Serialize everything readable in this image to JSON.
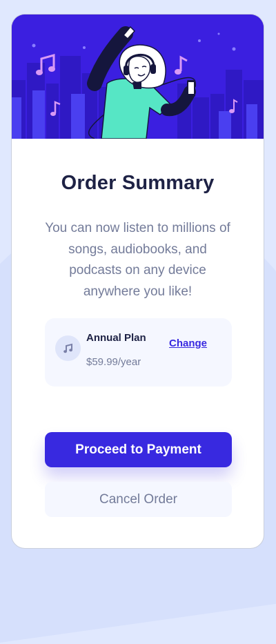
{
  "card": {
    "title": "Order Summary",
    "description": "You can now listen to millions of songs, audiobooks, and podcasts on any device anywhere you like!"
  },
  "plan": {
    "name": "Annual Plan",
    "price": "$59.99/year",
    "change_label": "Change",
    "icon": "music-note-icon"
  },
  "actions": {
    "proceed_label": "Proceed to Payment",
    "cancel_label": "Cancel Order"
  },
  "colors": {
    "background": "#e0e8fe",
    "accent": "#3829e0",
    "title": "#1e2245",
    "muted": "#737b99",
    "hero": "#3b1fe0"
  }
}
